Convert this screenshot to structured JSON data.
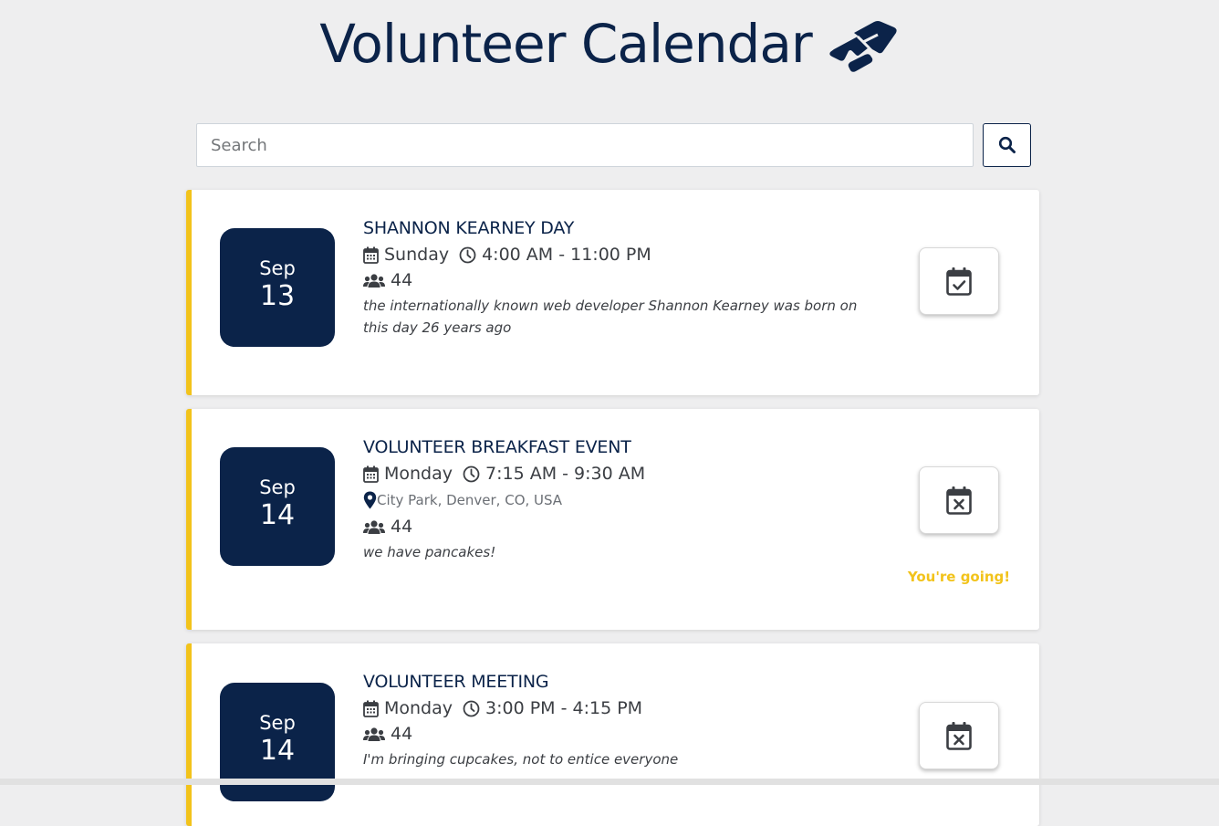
{
  "header": {
    "title": "Volunteer Calendar",
    "icon": "handshake-icon"
  },
  "search": {
    "placeholder": "Search",
    "value": "",
    "button_icon": "search-icon"
  },
  "colors": {
    "navy": "#0b2349",
    "accent_yellow": "#f2c31b",
    "background": "#eeeeef"
  },
  "events": [
    {
      "title": "SHANNON KEARNEY DAY",
      "month": "Sep",
      "day": "13",
      "weekday": "Sunday",
      "time": "4:00 AM - 11:00 PM",
      "location": "",
      "attendees": "44",
      "description": "the internationally known web developer Shannon Kearney was born on this day 26 years ago",
      "rsvp_icon": "calendar-check-icon",
      "status": ""
    },
    {
      "title": "VOLUNTEER BREAKFAST EVENT",
      "month": "Sep",
      "day": "14",
      "weekday": "Monday",
      "time": "7:15 AM - 9:30 AM",
      "location": "City Park, Denver, CO, USA",
      "attendees": "44",
      "description": "we have pancakes!",
      "rsvp_icon": "calendar-x-icon",
      "status": "You're going!"
    },
    {
      "title": "VOLUNTEER MEETING",
      "month": "Sep",
      "day": "14",
      "weekday": "Monday",
      "time": "3:00 PM - 4:15 PM",
      "location": "",
      "attendees": "44",
      "description": "I'm bringing cupcakes, not to entice everyone",
      "rsvp_icon": "calendar-x-icon",
      "status": ""
    }
  ]
}
